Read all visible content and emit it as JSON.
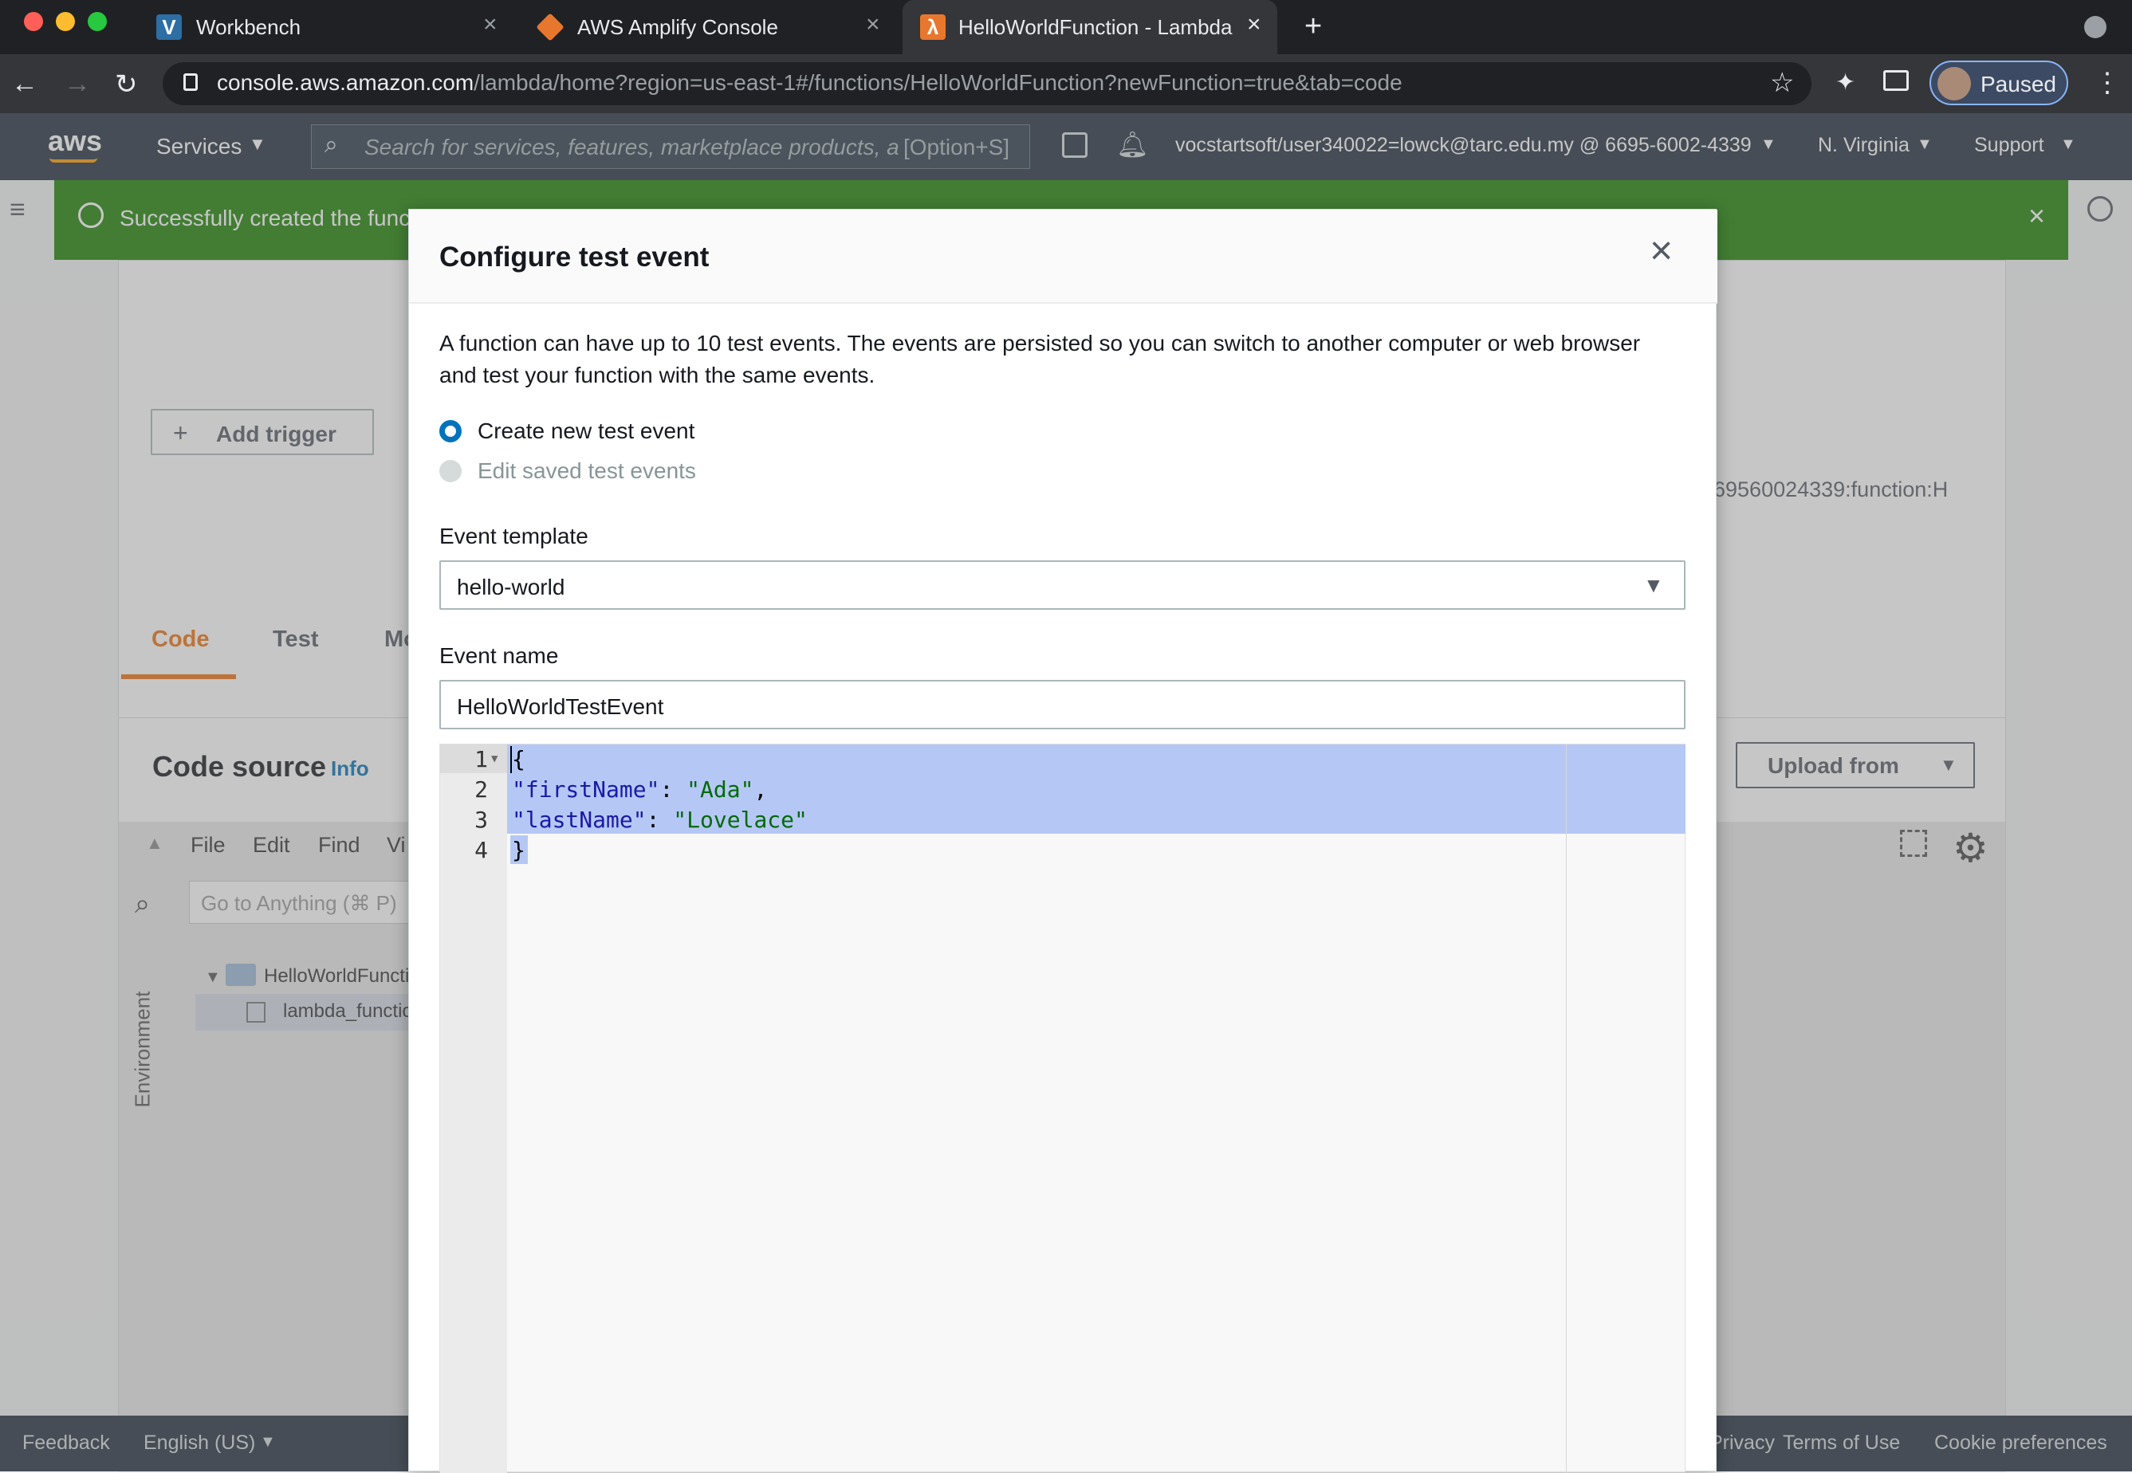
{
  "browser": {
    "tabs": [
      {
        "title": "Workbench",
        "icon": "vocareum-icon",
        "color": "#2d6ea4"
      },
      {
        "title": "AWS Amplify Console",
        "icon": "aws-cube-icon",
        "color": "#e8772e"
      },
      {
        "title": "HelloWorldFunction - Lambda",
        "icon": "lambda-icon",
        "color": "#e8772e",
        "active": true
      }
    ],
    "url_host": "console.aws.amazon.com",
    "url_path": "/lambda/home?region=us-east-1#/functions/HelloWorldFunction?newFunction=true&tab=code",
    "profile_label": "Paused"
  },
  "aws_nav": {
    "logo": "aws",
    "services": "Services",
    "search_placeholder": "Search for services, features, marketplace products, a",
    "search_shortcut": "[Option+S]",
    "account": "vocstartsoft/user340022=lowck@tarc.edu.my @ 6695-6002-4339",
    "region": "N. Virginia",
    "support": "Support"
  },
  "background": {
    "flash_message": "Successfully created the func",
    "add_trigger": "Add trigger",
    "arn_fragment": "69560024339:function:H",
    "tabs": [
      "Code",
      "Test",
      "Mo"
    ],
    "code_source": "Code source",
    "info": "Info",
    "upload_from": "Upload from",
    "menu": [
      "File",
      "Edit",
      "Find",
      "Vi"
    ],
    "goto_placeholder": "Go to Anything (⌘ P)",
    "environment": "Environment",
    "tree_folder": "HelloWorldFunction",
    "tree_file": "lambda_function",
    "footer": {
      "feedback": "Feedback",
      "language": "English (US)",
      "privacy": "Privacy",
      "terms": "Terms of Use",
      "cookies": "Cookie preferences"
    }
  },
  "modal": {
    "title": "Configure test event",
    "description_line1": "A function can have up to 10 test events. The events are persisted so you can switch to another computer or web browser",
    "description_line2": "and test your function with the same events.",
    "radio_create": "Create new test event",
    "radio_edit": "Edit saved test events",
    "template_label": "Event template",
    "template_value": "hello-world",
    "name_label": "Event name",
    "name_value": "HelloWorldTestEvent",
    "editor": {
      "line_numbers": [
        "1",
        "2",
        "3",
        "4"
      ],
      "open_brace": "{",
      "key1": "\"firstName\"",
      "val1": "\"Ada\"",
      "key2": "\"lastName\"",
      "val2": "\"Lovelace\"",
      "close_brace": "}",
      "colon": ": ",
      "comma": ","
    }
  },
  "colors": {
    "aws_orange": "#ff9900",
    "selection": "#b5c8f5",
    "radio_selected": "#0073bb"
  }
}
